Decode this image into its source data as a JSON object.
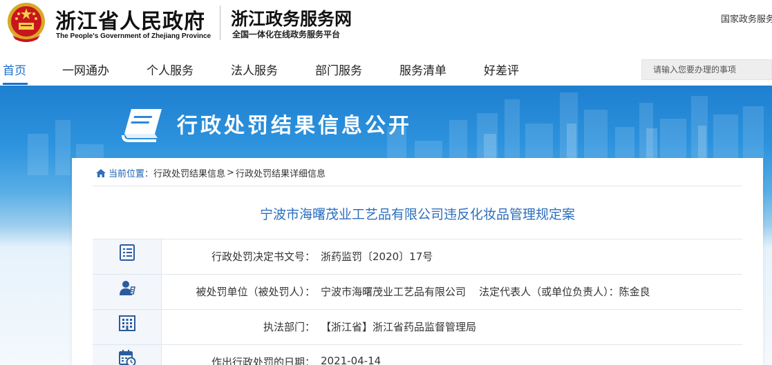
{
  "header": {
    "gov_title": "浙江省人民政府",
    "gov_subtitle": "The People's Government of Zhejiang Province",
    "portal_title": "浙江政务服务网",
    "portal_subtitle": "全国一体化在线政务服务平台",
    "top_right_link": "国家政务服务"
  },
  "nav": {
    "items": [
      {
        "label": "首页",
        "active": true
      },
      {
        "label": "一网通办"
      },
      {
        "label": "个人服务"
      },
      {
        "label": "法人服务"
      },
      {
        "label": "部门服务"
      },
      {
        "label": "服务清单"
      },
      {
        "label": "好差评"
      }
    ],
    "search_placeholder": "请输入您要办理的事项"
  },
  "banner": {
    "title": "行政处罚结果信息公开"
  },
  "breadcrumb": {
    "label": "当前位置：",
    "items": [
      "行政处罚结果信息",
      "行政处罚结果详细信息"
    ],
    "separator": ">"
  },
  "case": {
    "title": "宁波市海曙茂业工艺品有限公司违反化妆品管理规定案",
    "rows": [
      {
        "icon": "document-list-icon",
        "label": "行政处罚决定书文号：",
        "value": "浙药监罚〔2020〕17号"
      },
      {
        "icon": "person-icon",
        "label": "被处罚单位（被处罚人）：",
        "value": "宁波市海曙茂业工艺品有限公司    法定代表人（或单位负责人）：陈金良"
      },
      {
        "icon": "building-icon",
        "label": "执法部门：",
        "value": "【浙江省】浙江省药品监督管理局"
      },
      {
        "icon": "calendar-clock-icon",
        "label": "作出行政处罚的日期：",
        "value": "2021-04-14"
      }
    ]
  },
  "colors": {
    "accent": "#1a6fd0",
    "case_title": "#2c6fbd",
    "banner_top": "#1e7fd0"
  }
}
